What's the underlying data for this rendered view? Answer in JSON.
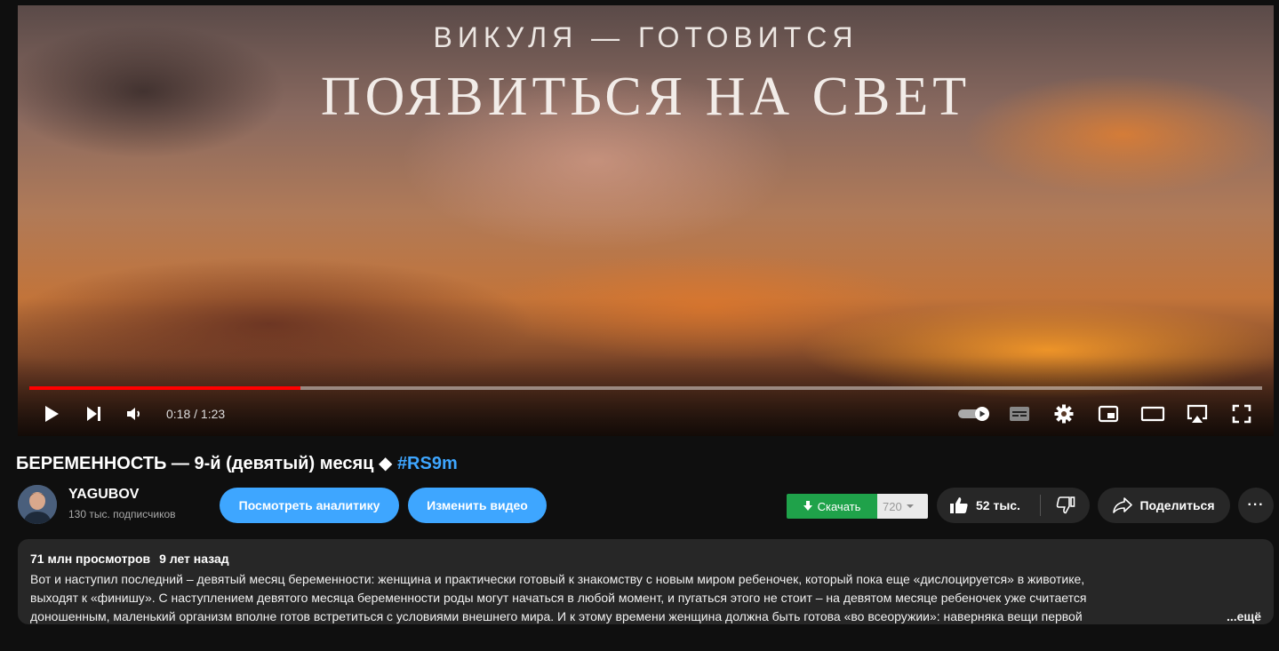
{
  "video": {
    "overlay_subtitle": "ВИКУЛЯ — ГОТОВИТСЯ",
    "overlay_title": "ПОЯВИТЬСЯ НА СВЕТ",
    "progress": 0.22,
    "time": "0:18 / 1:23"
  },
  "title": {
    "text": "БЕРЕМЕННОСТЬ — 9-й (девятый) месяц ◆",
    "hashtag": "#RS9m"
  },
  "channel": {
    "name": "YAGUBOV",
    "subscribers": "130 тыс. подписчиков"
  },
  "actions": {
    "analytics": "Посмотреть аналитику",
    "edit": "Изменить видео",
    "download": "Скачать",
    "quality": "720",
    "likes": "52 тыс.",
    "share": "Поделиться",
    "more": "···"
  },
  "description": {
    "views": "71 млн просмотров",
    "age": "9 лет назад",
    "line1": "Вот и наступил последний – девятый месяц беременности: женщина и практически готовый к знакомству с новым миром ребеночек, который пока еще «дислоцируется» в животике,",
    "line2": "выходят к «финишу». С наступлением девятого месяца беременности роды могут начаться в любой момент, и пугаться этого не стоит – на девятом месяце ребеночек уже считается",
    "line3": "доношенным, маленький организм вполне готов встретиться с условиями внешнего мира. И к этому времени женщина должна быть готова «во всеоружии»: наверняка вещи первой",
    "more": "...ещё"
  }
}
